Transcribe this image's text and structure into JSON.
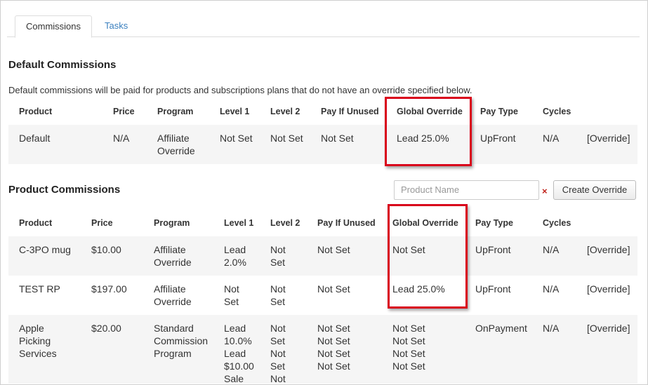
{
  "tabs": [
    {
      "label": "Commissions"
    },
    {
      "label": "Tasks"
    }
  ],
  "default_section": {
    "title": "Default Commissions",
    "description": "Default commissions will be paid for products and subscriptions plans that do not have an override specified below.",
    "headers": [
      "Product",
      "Price",
      "Program",
      "Level 1",
      "Level 2",
      "Pay If Unused",
      "Global Override",
      "Pay Type",
      "Cycles"
    ],
    "row": {
      "product": "Default",
      "price": "N/A",
      "program_line1": "Affiliate",
      "program_line2": "Override",
      "level1": "Not Set",
      "level2": "Not Set",
      "pay_if_unused": "Not Set",
      "global_override": "Lead 25.0%",
      "pay_type": "UpFront",
      "cycles": "N/A",
      "action": "[Override]"
    }
  },
  "product_section": {
    "title": "Product Commissions",
    "search_placeholder": "Product Name",
    "clear_icon": "×",
    "create_button": "Create Override",
    "headers": [
      "Product",
      "Price",
      "Program",
      "Level 1",
      "Level 2",
      "Pay If Unused",
      "Global Override",
      "Pay Type",
      "Cycles"
    ],
    "rows": [
      {
        "product": [
          "C-3PO mug"
        ],
        "price": "$10.00",
        "program": [
          "Affiliate",
          "Override"
        ],
        "level1": [
          "Lead",
          "2.0%"
        ],
        "level2": [
          "Not",
          "Set"
        ],
        "pay_if_unused": [
          "Not Set"
        ],
        "global_override": [
          "Not Set"
        ],
        "pay_type": "UpFront",
        "cycles": "N/A",
        "action": "[Override]"
      },
      {
        "product": [
          "TEST RP"
        ],
        "price": "$197.00",
        "program": [
          "Affiliate",
          "Override"
        ],
        "level1": [
          "Not",
          "Set"
        ],
        "level2": [
          "Not",
          "Set"
        ],
        "pay_if_unused": [
          "Not Set"
        ],
        "global_override": [
          "Lead 25.0%"
        ],
        "pay_type": "UpFront",
        "cycles": "N/A",
        "action": "[Override]"
      },
      {
        "product": [
          "Apple",
          "Picking",
          "Services"
        ],
        "price": "$20.00",
        "program": [
          "Standard",
          "Commission",
          "Program"
        ],
        "level1": [
          "Lead",
          "10.0%",
          "Lead",
          "$10.00",
          "Sale"
        ],
        "level2": [
          "Not",
          "Set",
          "Not",
          "Set",
          "Not"
        ],
        "pay_if_unused": [
          "Not Set",
          "Not Set",
          "Not Set",
          "Not Set"
        ],
        "global_override": [
          "Not Set",
          "Not Set",
          "Not Set",
          "Not Set"
        ],
        "pay_type": "OnPayment",
        "cycles": "N/A",
        "action": "[Override]"
      }
    ]
  },
  "colors": {
    "link": "#3a7fbf",
    "highlight_box": "#d9001b",
    "row_shade": "#f5f5f5"
  }
}
